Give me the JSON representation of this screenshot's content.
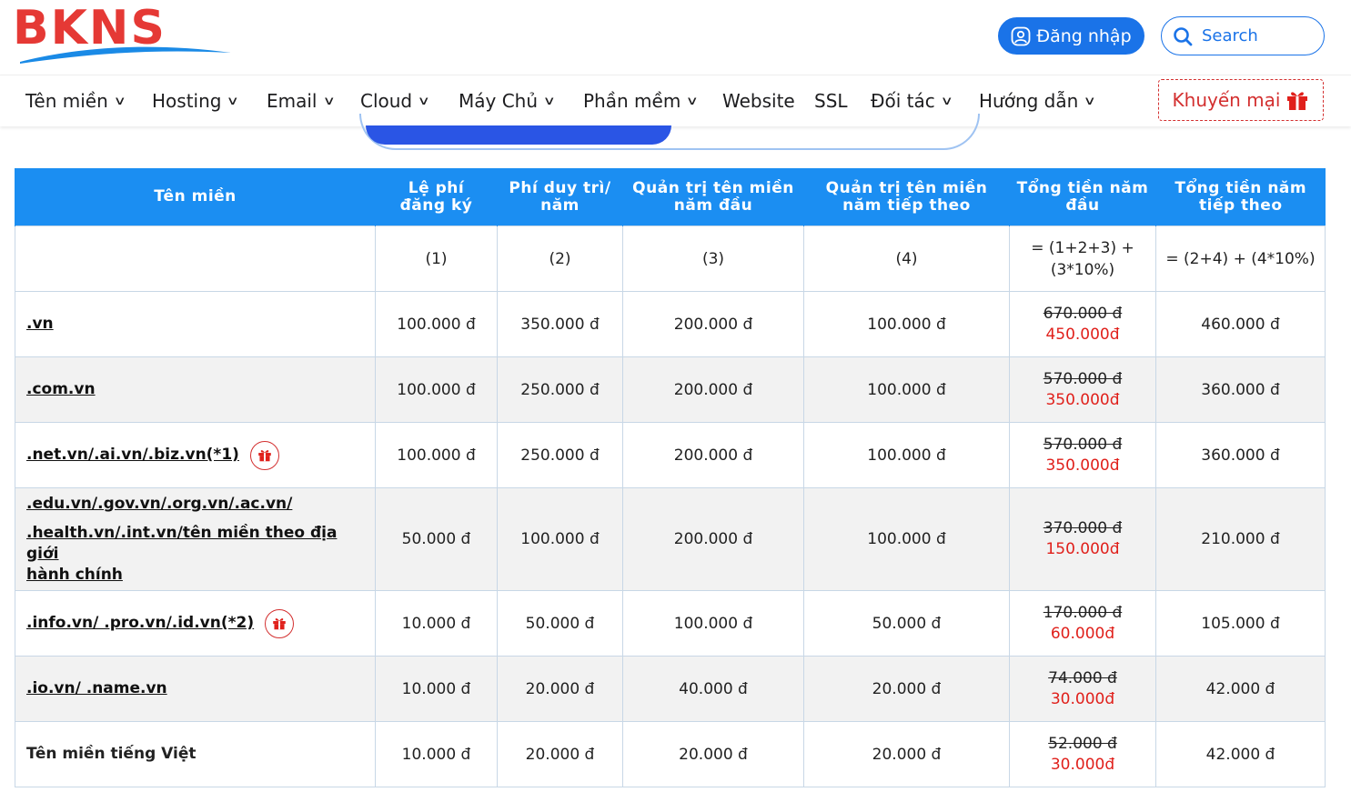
{
  "header": {
    "brand": "BKNS",
    "login_label": "Đăng nhập",
    "search_placeholder": "Search"
  },
  "nav": {
    "items": [
      {
        "label": "Tên miền",
        "dropdown": true
      },
      {
        "label": "Hosting",
        "dropdown": true
      },
      {
        "label": "Email",
        "dropdown": true
      },
      {
        "label": "Cloud",
        "dropdown": true
      },
      {
        "label": "Máy Chủ",
        "dropdown": true
      },
      {
        "label": "Phần mềm",
        "dropdown": true
      },
      {
        "label": "Website",
        "dropdown": false
      },
      {
        "label": "SSL",
        "dropdown": false
      },
      {
        "label": "Đối tác",
        "dropdown": true
      },
      {
        "label": "Hướng dẫn",
        "dropdown": true
      }
    ],
    "promo_label": "Khuyến mại"
  },
  "colors": {
    "brand_red": "#e53935",
    "brand_blue": "#1a73e8",
    "table_header": "#1b8ef2",
    "sale_red": "#e0201b"
  },
  "table": {
    "columns": [
      {
        "line1": "Tên miền",
        "line2": ""
      },
      {
        "line1": "Lệ phí",
        "line2": "đăng ký"
      },
      {
        "line1": "Phí duy trì/",
        "line2": "năm"
      },
      {
        "line1": "Quản trị tên miền",
        "line2": "năm đầu"
      },
      {
        "line1": "Quản trị tên miền",
        "line2": "năm tiếp theo"
      },
      {
        "line1": "Tổng tiền năm",
        "line2": "đầu"
      },
      {
        "line1": "Tổng tiền năm",
        "line2": "tiếp theo"
      }
    ],
    "formula_row": {
      "c1": "(1)",
      "c2": "(2)",
      "c3": "(3)",
      "c4": "(4)",
      "c5_line1": "= (1+2+3) +",
      "c5_line2": "(3*10%)",
      "c6": "= (2+4) + (4*10%)"
    },
    "rows": [
      {
        "name_lines": [
          ".vn"
        ],
        "gift": false,
        "link": true,
        "reg": "100.000 đ",
        "maint": "350.000 đ",
        "admin1": "200.000 đ",
        "admin2": "100.000 đ",
        "total_old": "670.000 đ",
        "total_new": "450.000đ",
        "next": "460.000 đ"
      },
      {
        "name_lines": [
          ".com.vn"
        ],
        "gift": false,
        "link": true,
        "reg": "100.000 đ",
        "maint": "250.000 đ",
        "admin1": "200.000 đ",
        "admin2": "100.000 đ",
        "total_old": "570.000 đ",
        "total_new": "350.000đ",
        "next": "360.000 đ"
      },
      {
        "name_lines": [
          ".net.vn/.ai.vn/.biz.vn(*1)"
        ],
        "gift": true,
        "link": true,
        "reg": "100.000 đ",
        "maint": "250.000 đ",
        "admin1": "200.000 đ",
        "admin2": "100.000 đ",
        "total_old": "570.000 đ",
        "total_new": "350.000đ",
        "next": "360.000 đ"
      },
      {
        "name_lines": [
          ".edu.vn/.gov.vn/.org.vn/.ac.vn/",
          ".health.vn/.int.vn/tên miền theo địa giới",
          "hành chính"
        ],
        "gift": false,
        "link": true,
        "tall": true,
        "reg": "50.000 đ",
        "maint": "100.000 đ",
        "admin1": "200.000 đ",
        "admin2": "100.000 đ",
        "total_old": "370.000 đ",
        "total_new": "150.000đ",
        "next": "210.000 đ"
      },
      {
        "name_lines": [
          ".info.vn/ .pro.vn/.id.vn(*2)"
        ],
        "gift": true,
        "link": true,
        "reg": "10.000 đ",
        "maint": "50.000 đ",
        "admin1": "100.000 đ",
        "admin2": "50.000 đ",
        "total_old": "170.000 đ",
        "total_new": "60.000đ",
        "next": "105.000 đ"
      },
      {
        "name_lines": [
          ".io.vn/ .name.vn"
        ],
        "gift": false,
        "link": true,
        "reg": "10.000 đ",
        "maint": "20.000 đ",
        "admin1": "40.000 đ",
        "admin2": "20.000 đ",
        "total_old": "74.000 đ",
        "total_new": "30.000đ",
        "next": "42.000 đ"
      },
      {
        "name_lines": [
          "Tên miền tiếng Việt"
        ],
        "gift": false,
        "link": false,
        "reg": "10.000 đ",
        "maint": "20.000 đ",
        "admin1": "20.000 đ",
        "admin2": "20.000 đ",
        "total_old": "52.000 đ",
        "total_new": "30.000đ",
        "next": "42.000 đ"
      }
    ]
  }
}
